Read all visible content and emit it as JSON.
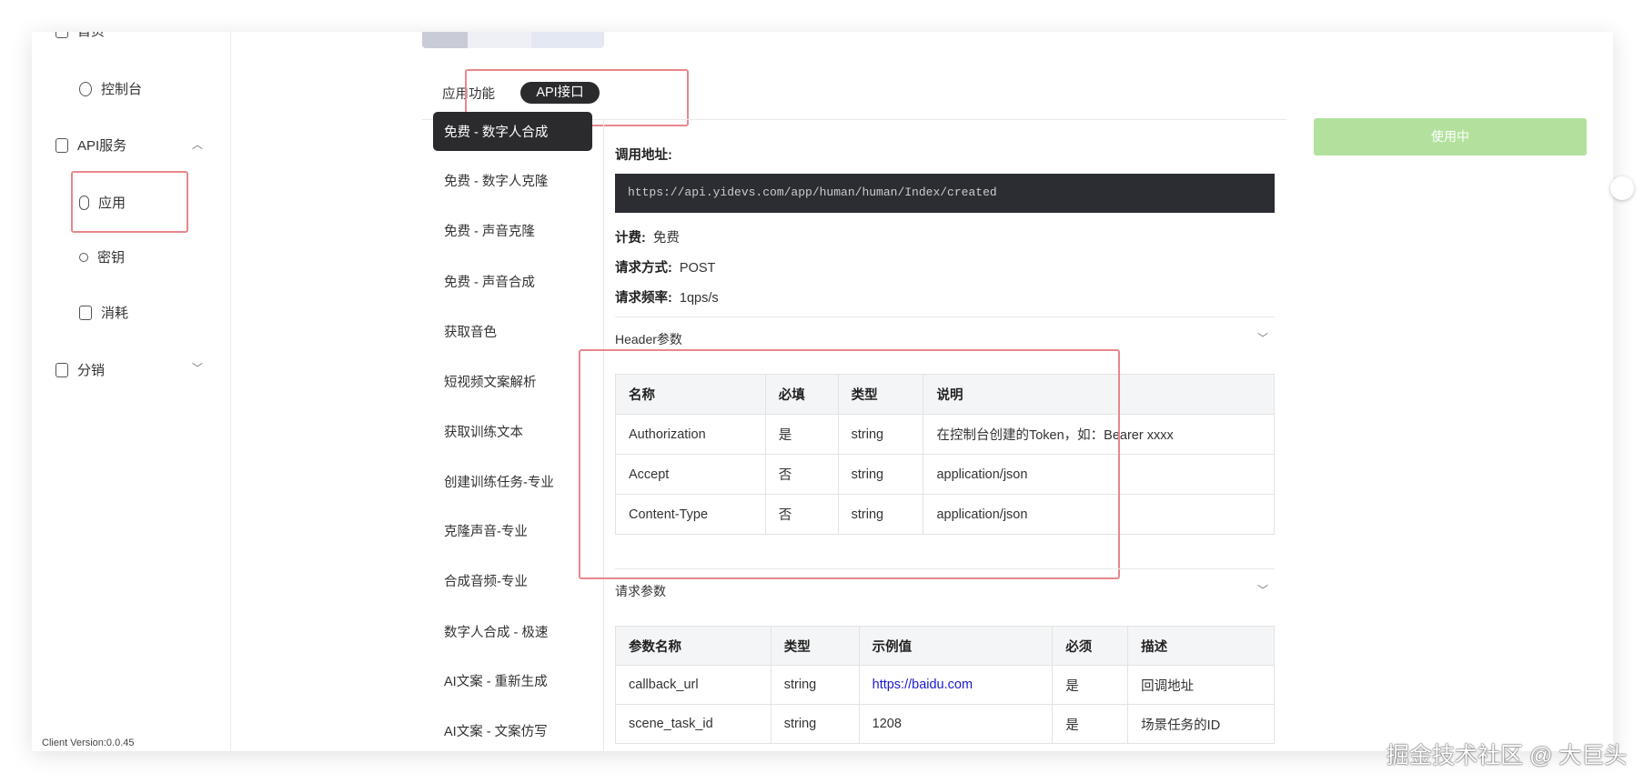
{
  "sidebar": {
    "items": [
      {
        "label": "首页"
      },
      {
        "label": "控制台"
      },
      {
        "label": "API服务"
      },
      {
        "label": "应用"
      },
      {
        "label": "密钥"
      },
      {
        "label": "消耗"
      },
      {
        "label": "分销"
      }
    ],
    "version": "Client Version:0.0.45"
  },
  "tabs": [
    {
      "label": "应用功能"
    },
    {
      "label": "API接口"
    }
  ],
  "api_list": [
    "免费 - 数字人合成",
    "免费 - 数字人克隆",
    "免费 - 声音克隆",
    "免费 - 声音合成",
    "获取音色",
    "短视频文案解析",
    "获取训练文本",
    "创建训练任务-专业",
    "克隆声音-专业",
    "合成音频-专业",
    "数字人合成 - 极速",
    "AI文案 - 重新生成",
    "AI文案 - 文案仿写"
  ],
  "detail": {
    "url_label": "调用地址:",
    "url": "https://api.yidevs.com/app/human/human/Index/created",
    "billing_label": "计费:",
    "billing": "免费",
    "method_label": "请求方式:",
    "method": "POST",
    "rate_label": "请求频率:",
    "rate": "1qps/s",
    "header_section": "Header参数",
    "request_section": "请求参数"
  },
  "header_table": {
    "columns": [
      "名称",
      "必填",
      "类型",
      "说明"
    ],
    "rows": [
      [
        "Authorization",
        "是",
        "string",
        "在控制台创建的Token，如：Bearer xxxx"
      ],
      [
        "Accept",
        "否",
        "string",
        "application/json"
      ],
      [
        "Content-Type",
        "否",
        "string",
        "application/json"
      ]
    ]
  },
  "param_table": {
    "columns": [
      "参数名称",
      "类型",
      "示例值",
      "必须",
      "描述"
    ],
    "rows": [
      [
        "callback_url",
        "string",
        "https://baidu.com",
        "是",
        "回调地址"
      ],
      [
        "scene_task_id",
        "string",
        "1208",
        "是",
        "场景任务的ID"
      ]
    ]
  },
  "use_button": "使用中",
  "watermark": "掘金技术社区 @ 大巨头"
}
